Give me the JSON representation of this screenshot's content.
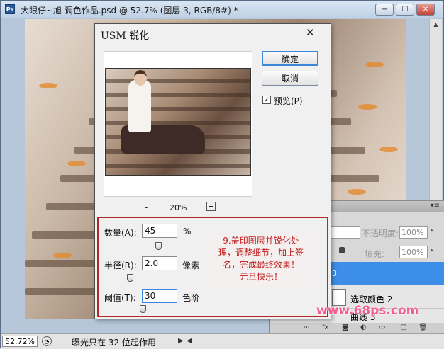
{
  "window": {
    "title": "大眼仔~旭 调色作品.psd @ 52.7% (图层 3, RGB/8#) *",
    "app_icon": "Ps",
    "minimize": "−",
    "maximize": "☐",
    "close": "✕"
  },
  "status": {
    "zoom": "52.72%",
    "text": "曝光只在 32 位起作用",
    "arrow": "▶",
    "scroll_left": "◀"
  },
  "layers": {
    "opacity_label": "不透明度:",
    "opacity_value": "100%",
    "fill_label": "填充:",
    "fill_value": "100%",
    "dropdown_arrow": "▸",
    "menu_icon": "▾≡",
    "rows": [
      {
        "name": "3"
      },
      {
        "name": "选取颜色 2"
      },
      {
        "name": "曲线 3"
      }
    ],
    "footer_icons": [
      "∞",
      "fx",
      "◙",
      "◐",
      "▭",
      "▢",
      "🗑"
    ]
  },
  "dialog": {
    "title": "USM 锐化",
    "close": "✕",
    "ok_label": "确定",
    "cancel_label": "取消",
    "preview_label": "预览(P)",
    "preview_checked": "✓",
    "zoom_minus": "-",
    "zoom_value": "20%",
    "zoom_plus": "+",
    "amount": {
      "label": "数量(A):",
      "value": "45",
      "unit": "%"
    },
    "radius": {
      "label": "半径(R):",
      "value": "2.0",
      "unit": "像素"
    },
    "threshold": {
      "label": "阈值(T):",
      "value": "30",
      "unit": "色阶"
    }
  },
  "note": {
    "lines": [
      "9.盖印图层并锐化处",
      "理，调整细节，加上签",
      "名，完成最终效果！",
      "元旦快乐！"
    ]
  },
  "watermark": "www.68ps.com",
  "colors": {
    "accent_blue": "#3d8ee6",
    "annotation_red": "#c21a1a",
    "watermark_pink": "#f06090"
  }
}
